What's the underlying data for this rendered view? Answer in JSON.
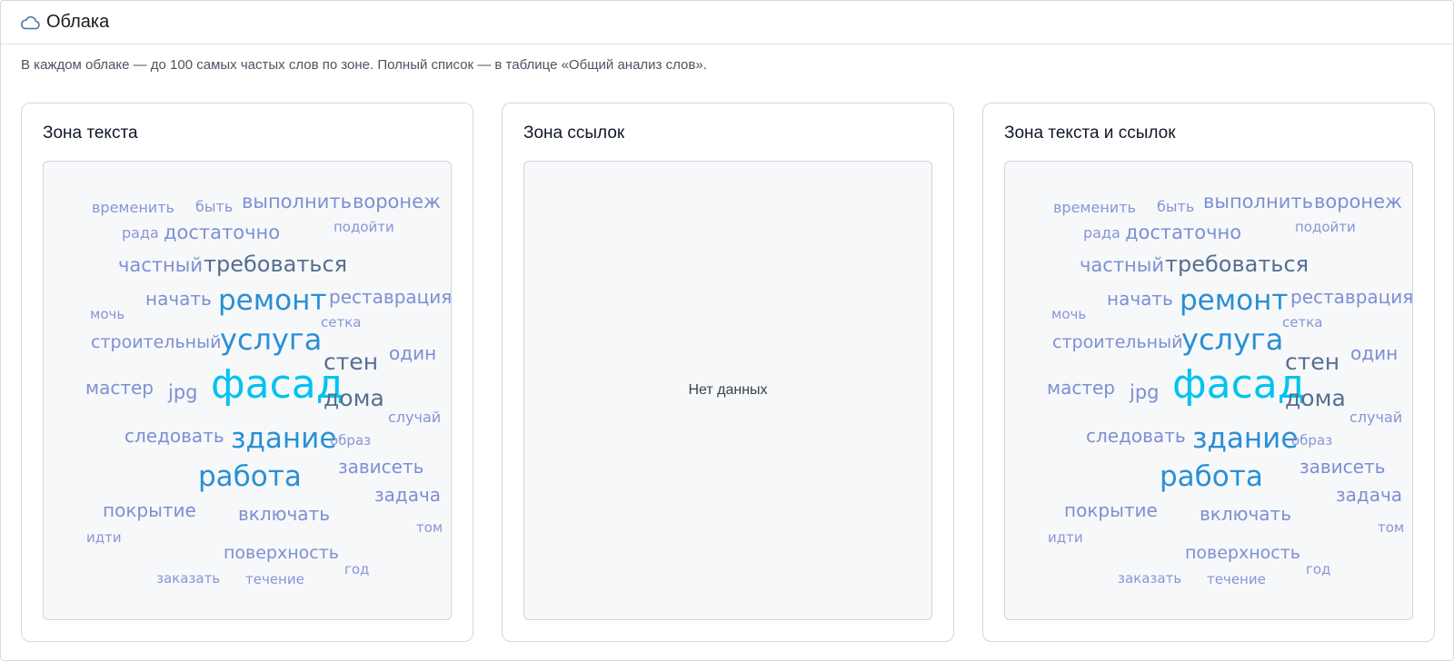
{
  "header": {
    "title": "Облака",
    "icon": "cloud-icon"
  },
  "hint": "В каждом облаке — до 100 самых частых слов по зоне. Полный список — в таблице «Общий анализ слов».",
  "colors": {
    "c1": "#00c3ee",
    "c2": "#2a8fd4",
    "c3": "#566f8f",
    "c4": "#7e8fd2",
    "c5": "#8795d6"
  },
  "panels": [
    {
      "title": "Зона текста",
      "empty": false
    },
    {
      "title": "Зона ссылок",
      "empty": true,
      "empty_text": "Нет данных"
    },
    {
      "title": "Зона текста и ссылок",
      "empty": false
    }
  ],
  "words": [
    "фасад",
    "ремонт",
    "услуга",
    "здание",
    "работа",
    "стен",
    "дома",
    "требоваться",
    "выполнить",
    "воронеж",
    "достаточно",
    "частный",
    "начать",
    "реставрация",
    "строительный",
    "один",
    "мастер",
    "jpg",
    "следовать",
    "зависеть",
    "задача",
    "покрытие",
    "включать",
    "поверхность",
    "временить",
    "быть",
    "рада",
    "подойти",
    "мочь",
    "сетка",
    "случай",
    "образ",
    "идти",
    "том",
    "заказать",
    "течение",
    "год"
  ]
}
